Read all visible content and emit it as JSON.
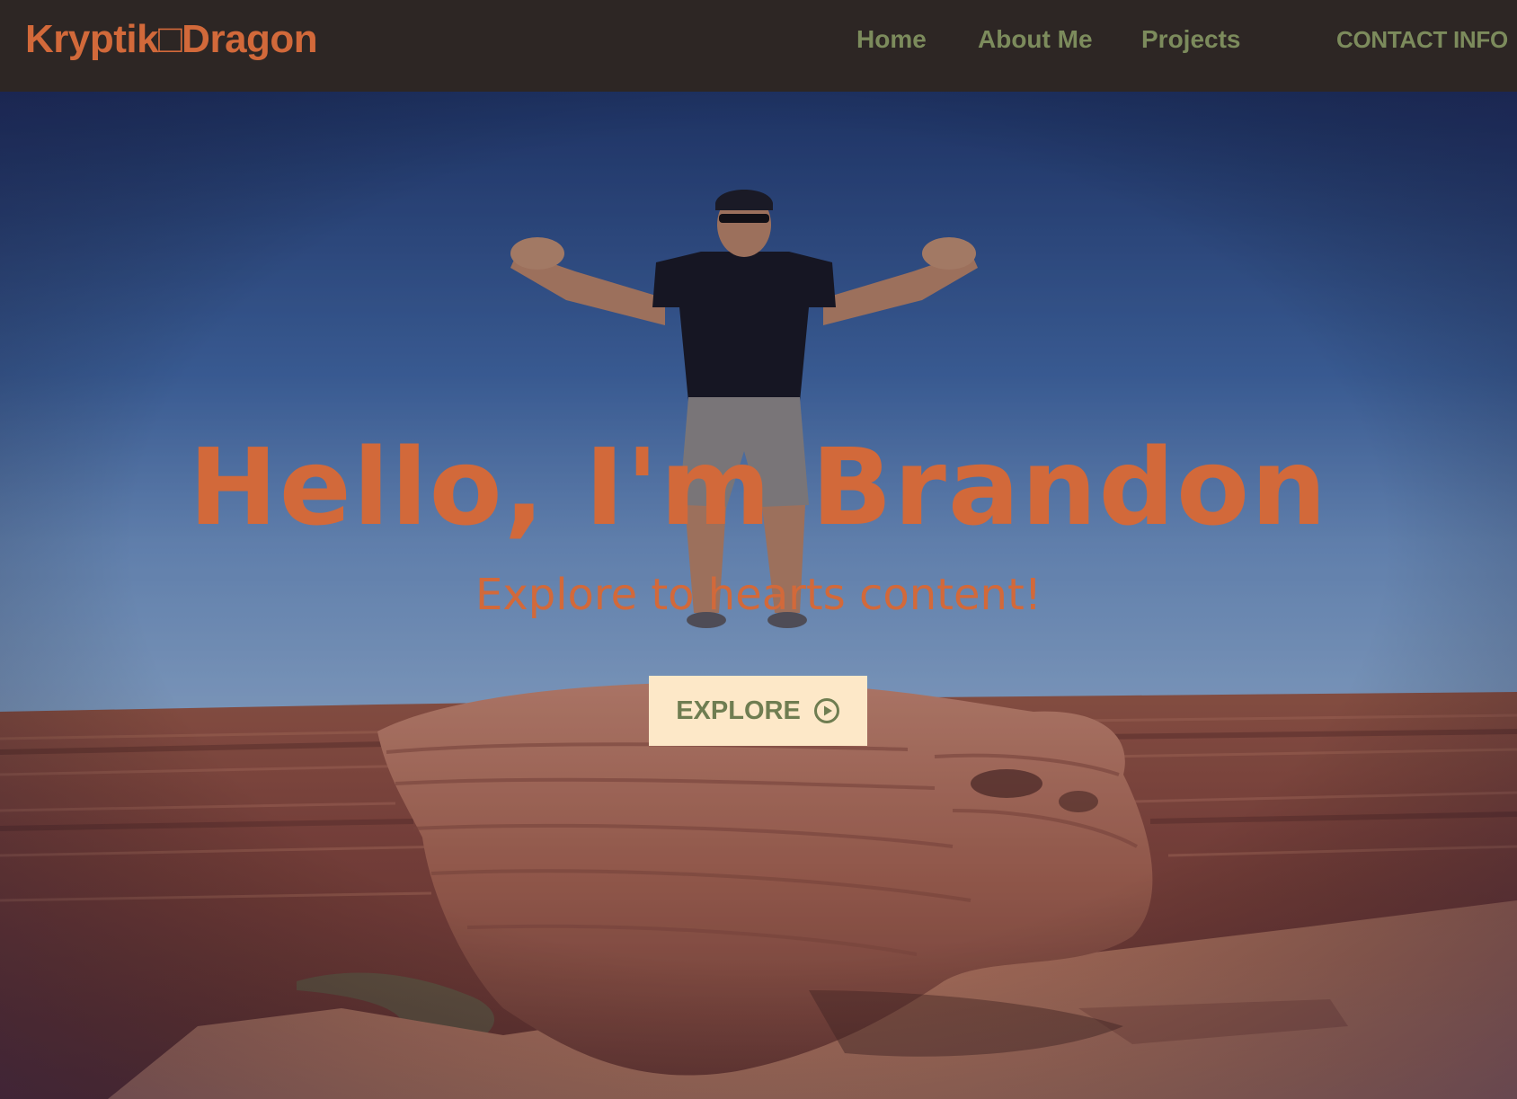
{
  "navbar": {
    "brand": "Kryptik□Dragon",
    "links": [
      {
        "label": "Home"
      },
      {
        "label": "About Me"
      },
      {
        "label": "Projects"
      },
      {
        "label": "CONTACT INFO"
      }
    ]
  },
  "hero": {
    "title": "Hello, I'm Brandon",
    "subtitle": "Explore to hearts content!",
    "button": {
      "label": "EXPLORE",
      "icon": "play-circle-icon"
    },
    "background_image": "photo of a man with outstretched arms standing on a red sandstone rock above a canyon under a blue sky"
  },
  "colors": {
    "navbar_bg": "#2d2624",
    "brand": "#d2693a",
    "nav_link": "#7c8b5c",
    "hero_text": "#d2693a",
    "button_bg": "#fde8c8",
    "button_text": "#6f7d51"
  }
}
